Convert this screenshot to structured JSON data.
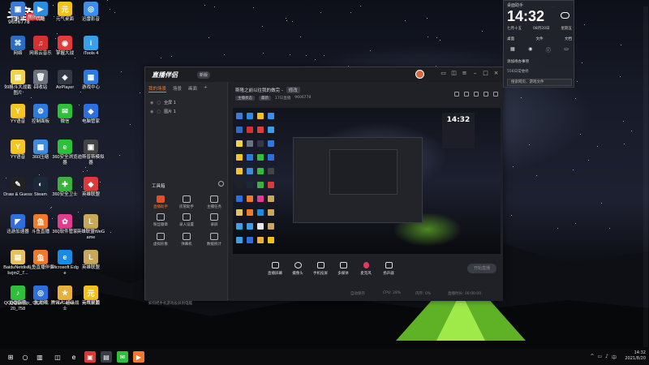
{
  "desktop": {
    "logo": {
      "mark": "斗鱼",
      "tag": "房间号",
      "room": "9606778"
    },
    "icons": [
      {
        "label": "此电脑",
        "glyph": "▣",
        "color": "#3a7bd5"
      },
      {
        "label": "优酷",
        "glyph": "▶",
        "color": "#2a8de0"
      },
      {
        "label": "元气桌面",
        "glyph": "元",
        "color": "#f2c21b"
      },
      {
        "label": "迅雷影音",
        "glyph": "◎",
        "color": "#3b8ef0"
      },
      {
        "label": "网络",
        "glyph": "⌘",
        "color": "#2d6cc2"
      },
      {
        "label": "网易云音乐",
        "glyph": "♫",
        "color": "#d63131"
      },
      {
        "label": "掌握大战",
        "glyph": "◉",
        "color": "#e23b3b"
      },
      {
        "label": "iTools 4",
        "glyph": "i",
        "color": "#3a9ee8"
      },
      {
        "label": "99格斗大战截图片",
        "glyph": "▤",
        "color": "#f4d34a"
      },
      {
        "label": "回收站",
        "glyph": "🗑",
        "color": "#6c7380"
      },
      {
        "label": "AirPlayer",
        "glyph": "◈",
        "color": "#333a45"
      },
      {
        "label": "游戏中心",
        "glyph": "▦",
        "color": "#2d7be0"
      },
      {
        "label": "YY语音",
        "glyph": "Y",
        "color": "#f5c623"
      },
      {
        "label": "控制面板",
        "glyph": "⚙",
        "color": "#2d7be0"
      },
      {
        "label": "微信",
        "glyph": "✉",
        "color": "#2fbf3b"
      },
      {
        "label": "电脑管家",
        "glyph": "◆",
        "color": "#2e6fe0"
      },
      {
        "label": "YY语音",
        "glyph": "Y",
        "color": "#f5c623"
      },
      {
        "label": "360压缩",
        "glyph": "▩",
        "color": "#3a8de0"
      },
      {
        "label": "360安全浏览器",
        "glyph": "e",
        "color": "#2fbf3b"
      },
      {
        "label": "迪斯普斯模拟器",
        "glyph": "▣",
        "color": "#444"
      },
      {
        "label": "Draw & Guess",
        "glyph": "✎",
        "color": "#222"
      },
      {
        "label": "Steam",
        "glyph": "◐",
        "color": "#1b2838"
      },
      {
        "label": "360安全卫士",
        "glyph": "✚",
        "color": "#3bb23b"
      },
      {
        "label": "英雄联盟",
        "glyph": "◆",
        "color": "#d93a3a"
      },
      {
        "label": "迅游加速器",
        "glyph": "◤",
        "color": "#2e6fe0"
      },
      {
        "label": "斗鱼直播",
        "glyph": "鱼",
        "color": "#f07a2a"
      },
      {
        "label": "360软件管家",
        "glyph": "✿",
        "color": "#e23b8f"
      },
      {
        "label": "英雄联盟WeGame",
        "glyph": "L",
        "color": "#c9a85a"
      },
      {
        "label": "BaiduNetdisk_bzjm2_7...",
        "glyph": "▤",
        "color": "#e8c25a"
      },
      {
        "label": "斗鱼直播伴侣",
        "glyph": "鱼",
        "color": "#f07a2a"
      },
      {
        "label": "Microsoft Edge",
        "glyph": "e",
        "color": "#1d8ae0"
      },
      {
        "label": "英雄联盟",
        "glyph": "L",
        "color": "#c9a85a"
      },
      {
        "label": "QQliveSetup_20_758",
        "glyph": "▶",
        "color": "#3ba0e8"
      },
      {
        "label": "QQ游戏",
        "glyph": "◉",
        "color": "#3b9ee8"
      },
      {
        "label": "WeGame",
        "glyph": "W",
        "color": "#e8e8e8"
      },
      {
        "label": "英雄联盟",
        "glyph": "L",
        "color": "#c9a85a"
      },
      {
        "label": "迅雷网盘",
        "glyph": "✦",
        "color": "#3ba0e8"
      },
      {
        "label": "鲁大师",
        "glyph": "◎",
        "color": "#2e6fe0"
      },
      {
        "label": "腾讯人·超级战士",
        "glyph": "★",
        "color": "#e8b23a"
      },
      {
        "label": "元气桌面",
        "glyph": "元",
        "color": "#f2c21b"
      },
      {
        "label": "QQ音乐",
        "glyph": "♪",
        "color": "#2fbf3b"
      }
    ]
  },
  "app": {
    "title": "直播伴侣",
    "badge": "新版",
    "tabs": [
      "我的场景",
      "场景",
      "画面"
    ],
    "scenes": [
      "全屏 1",
      "图片 1"
    ],
    "tools_title": "工具箱",
    "tools": [
      {
        "label": "直播助手",
        "highlight": true
      },
      {
        "label": "房管助手",
        "highlight": false
      },
      {
        "label": "主播任务",
        "highlight": false
      },
      {
        "label": "粉丝徽章",
        "highlight": false
      },
      {
        "label": "录入设置",
        "highlight": false
      },
      {
        "label": "录屏",
        "highlight": false
      },
      {
        "label": "虚拟形象",
        "highlight": false
      },
      {
        "label": "弹幕机",
        "highlight": false
      },
      {
        "label": "数据统计",
        "highlight": false
      }
    ],
    "left_footer": "如何把手机游戏投屏到电脑",
    "header_text": "斯隆之前以往我的做完 -",
    "edit_label": "修改",
    "subline": [
      "主播状态",
      "最新",
      "17日直播",
      "9606778"
    ],
    "bottom_buttons": [
      "直播屏幕",
      "摄像头",
      "手机投屏",
      "多媒体",
      "麦克风",
      "扬声器"
    ],
    "start_live": "开始直播",
    "status": [
      "自动保存",
      "CPU: 28%",
      "内存: 0%",
      "直播时长: 00:00:00"
    ]
  },
  "widget": {
    "top_label": "桌面助手",
    "time": "14:32",
    "date_left": "七月十五",
    "date_mid": "08月20日",
    "date_right": "星期五",
    "links": [
      "桌面",
      "文件",
      "文档"
    ],
    "add_label": "添加待办事项",
    "news": "556日常维修",
    "search_placeholder": "搜索网页、游戏文件"
  },
  "taskbar": {
    "time": "14:32",
    "date": "2021/8/20"
  }
}
